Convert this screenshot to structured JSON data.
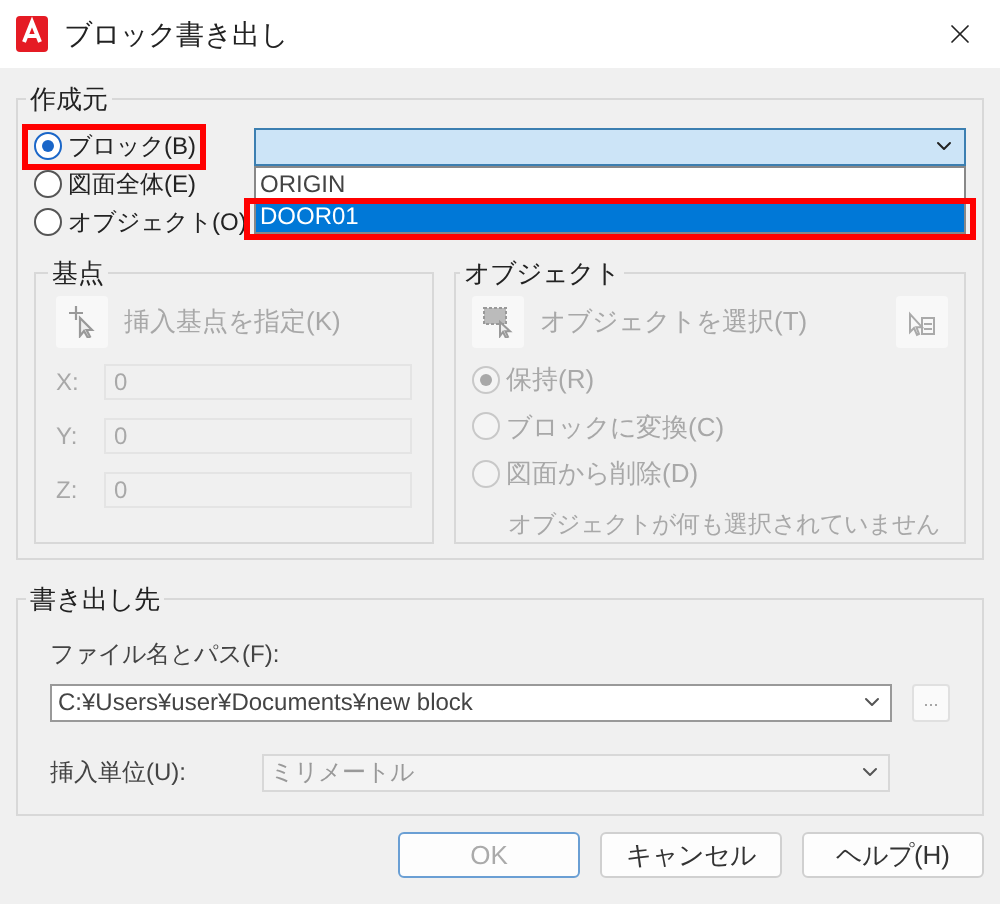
{
  "window": {
    "title": "ブロック書き出し"
  },
  "source": {
    "label": "作成元",
    "options": [
      {
        "label": "ブロック(B)",
        "selected": true,
        "highlighted": true
      },
      {
        "label": "図面全体(E)",
        "selected": false,
        "highlighted": false
      },
      {
        "label": "オブジェクト(O)",
        "selected": false,
        "highlighted": false
      }
    ],
    "block_dropdown": {
      "open": true,
      "items": [
        {
          "label": "ORIGIN",
          "selected": false,
          "highlighted": false
        },
        {
          "label": "DOOR01",
          "selected": true,
          "highlighted": true
        }
      ]
    }
  },
  "base_point": {
    "label": "基点",
    "disabled": true,
    "pick_button": "挿入基点を指定(K)",
    "coords": [
      {
        "axis": "X:",
        "value": "0"
      },
      {
        "axis": "Y:",
        "value": "0"
      },
      {
        "axis": "Z:",
        "value": "0"
      }
    ]
  },
  "objects": {
    "label": "オブジェクト",
    "disabled": true,
    "select_button": "オブジェクトを選択(T)",
    "options": [
      {
        "label": "保持(R)",
        "selected": true
      },
      {
        "label": "ブロックに変換(C)",
        "selected": false
      },
      {
        "label": "図面から削除(D)",
        "selected": false
      }
    ],
    "status": "オブジェクトが何も選択されていません"
  },
  "destination": {
    "label": "書き出し先",
    "file_label": "ファイル名とパス(F):",
    "file_path": "C:¥Users¥user¥Documents¥new block",
    "browse": "...",
    "units_label": "挿入単位(U):",
    "units_value": "ミリメートル",
    "units_disabled": true
  },
  "buttons": [
    {
      "label": "OK",
      "default": true,
      "disabled": true
    },
    {
      "label": "キャンセル",
      "default": false,
      "disabled": false
    },
    {
      "label": "ヘルプ(H)",
      "default": false,
      "disabled": false
    }
  ]
}
